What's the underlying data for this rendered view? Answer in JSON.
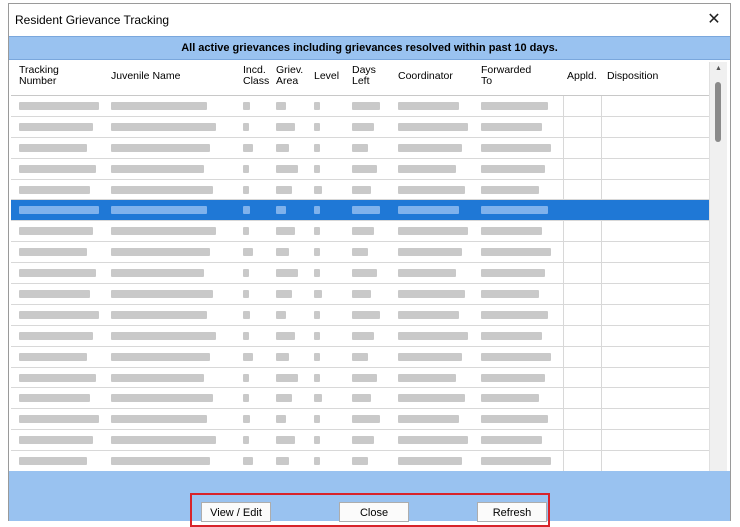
{
  "window": {
    "title": "Resident Grievance Tracking",
    "close_glyph": "✕"
  },
  "banner": {
    "text": "All active grievances including grievances resolved within past 10 days."
  },
  "columns": [
    {
      "label": "Tracking\nNumber"
    },
    {
      "label": "Juvenile Name"
    },
    {
      "label": "Incd.\nClass"
    },
    {
      "label": "Griev.\nArea"
    },
    {
      "label": "Level"
    },
    {
      "label": "Days\nLeft"
    },
    {
      "label": "Coordinator"
    },
    {
      "label": "Forwarded\nTo"
    },
    {
      "label": "Appld."
    },
    {
      "label": "Disposition"
    }
  ],
  "selected_row": 5,
  "row_count": 18,
  "buttons": {
    "view_edit": "View / Edit",
    "close": "Close",
    "refresh": "Refresh"
  }
}
